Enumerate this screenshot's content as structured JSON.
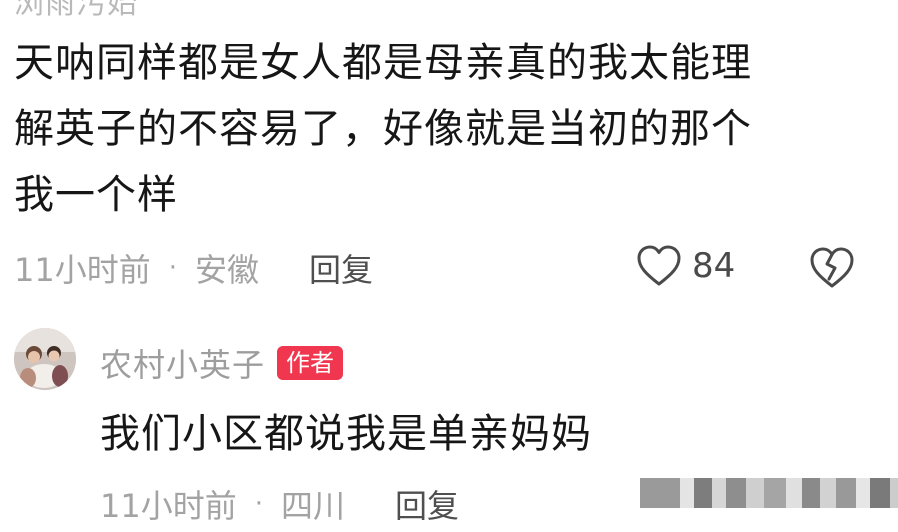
{
  "previous_user": {
    "name_fragment": "浏雨汚始"
  },
  "comment": {
    "lines": [
      "天呐同样都是女人都是母亲真的我太能理",
      "解英子的不容易了，好像就是当初的那个",
      "我一个样"
    ],
    "time": "11小时前",
    "separator": "·",
    "location": "安徽",
    "reply_label": "回复",
    "like_count": "84",
    "like_icon": "heart-outline-icon",
    "dislike_icon": "broken-heart-icon"
  },
  "reply": {
    "author_name": "农村小英子",
    "author_badge": "作者",
    "text": "我们小区都说我是单亲妈妈",
    "time": "11小时前",
    "separator": "·",
    "location": "四川",
    "reply_label": "回复"
  },
  "colors": {
    "badge": "#f0374f",
    "meta": "#a3a3a3",
    "text": "#161616"
  }
}
